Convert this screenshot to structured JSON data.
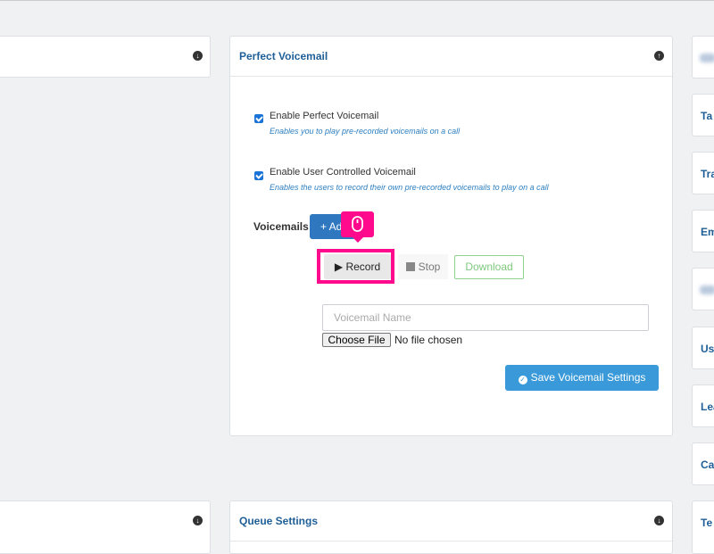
{
  "perfect_voicemail": {
    "title": "Perfect Voicemail",
    "options": [
      {
        "label": "Enable Perfect Voicemail",
        "help": "Enables you to play pre-recorded voicemails on a call",
        "checked": true
      },
      {
        "label": "Enable User Controlled Voicemail",
        "help": "Enables the users to record their own pre-recorded voicemails to play on a call",
        "checked": true
      }
    ],
    "voicemails_label": "Voicemails",
    "add_label": "+ Add",
    "record_label": "Record",
    "stop_label": "Stop",
    "download_label": "Download",
    "voicemail_name_placeholder": "Voicemail Name",
    "choose_file_label": "Choose File",
    "file_status": "No file chosen",
    "save_label": "Save Voicemail Settings"
  },
  "queue_settings": {
    "title": "Queue Settings"
  },
  "right_column": [
    "Ta",
    "Tra",
    "Em",
    "Us",
    "Lea",
    "Ca",
    "Te"
  ],
  "icons": {
    "expand": "circle-arrow-down-icon",
    "collapse": "circle-arrow-up-icon",
    "mouse": "mouse-click-icon"
  },
  "colors": {
    "accent": "#1f5f97",
    "highlight": "#ff0a8c",
    "save": "#3a9ad9",
    "add": "#2f78c0"
  }
}
